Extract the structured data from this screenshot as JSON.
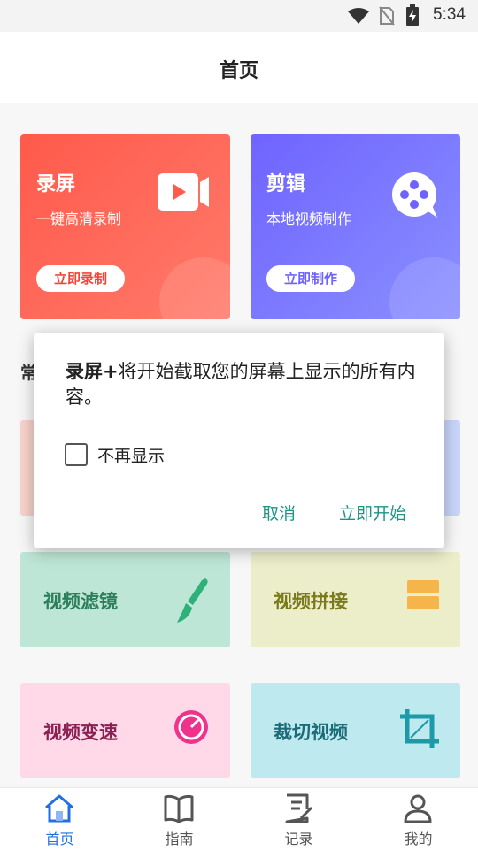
{
  "status_bar": {
    "time": "5:34"
  },
  "app_bar": {
    "title": "首页"
  },
  "cards": {
    "record": {
      "title": "录屏",
      "subtitle": "一键高清录制",
      "button": "立即录制",
      "button_color": "#f0463a"
    },
    "edit": {
      "title": "剪辑",
      "subtitle": "本地视频制作",
      "button": "立即制作",
      "button_color": "#6f63ff"
    }
  },
  "section": {
    "title_fragment": "常"
  },
  "tools": [
    {
      "label": "视频滤镜",
      "icon": "brush-icon",
      "bg": "#bde6d6",
      "color": "#2d7e5c"
    },
    {
      "label": "视频拼接",
      "icon": "stack-icon",
      "bg": "#ecedc9",
      "color": "#7a7a1c"
    },
    {
      "label": "视频变速",
      "icon": "speed-icon",
      "bg": "#ffd9e8",
      "color": "#8a1f52"
    },
    {
      "label": "裁切视频",
      "icon": "crop-icon",
      "bg": "#bde9ef",
      "color": "#1b6c78"
    }
  ],
  "dialog": {
    "message_bold": "录屏+",
    "message_rest": "将开始截取您的屏幕上显示的所有内容。",
    "checkbox_label": "不再显示",
    "cancel": "取消",
    "start": "立即开始"
  },
  "bottom_nav": [
    {
      "label": "首页",
      "icon": "home-icon",
      "active": true
    },
    {
      "label": "指南",
      "icon": "book-icon",
      "active": false
    },
    {
      "label": "记录",
      "icon": "notes-icon",
      "active": false
    },
    {
      "label": "我的",
      "icon": "person-icon",
      "active": false
    }
  ]
}
